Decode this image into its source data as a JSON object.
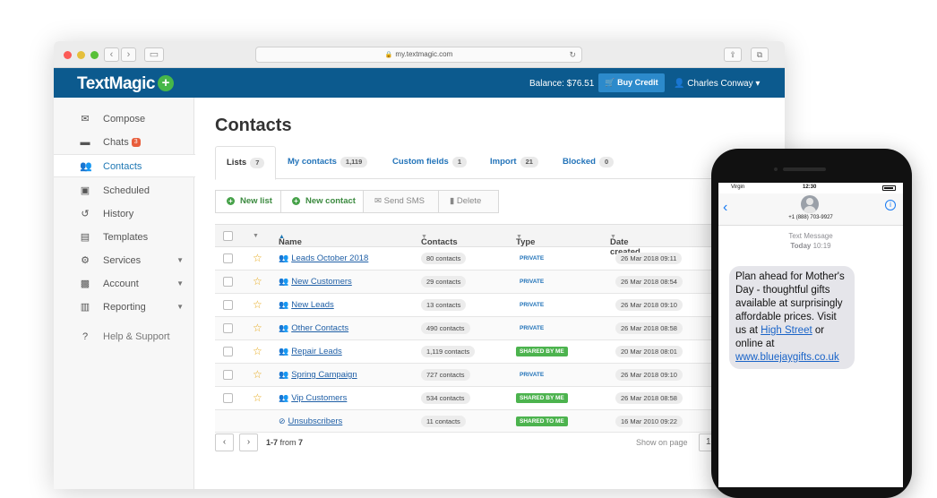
{
  "browser": {
    "url": "my.textmagic.com"
  },
  "header": {
    "logo": "TextMagic",
    "logo_plus": "+",
    "balance": "Balance: $76.51",
    "buy_credit": "Buy Credit",
    "user": "Charles Conway ▾"
  },
  "sidebar": {
    "items": [
      {
        "label": "Compose"
      },
      {
        "label": "Chats",
        "badge": "3"
      },
      {
        "label": "Contacts"
      },
      {
        "label": "Scheduled"
      },
      {
        "label": "History"
      },
      {
        "label": "Templates"
      },
      {
        "label": "Services"
      },
      {
        "label": "Account"
      },
      {
        "label": "Reporting"
      },
      {
        "label": "Help & Support"
      }
    ]
  },
  "main": {
    "title": "Contacts",
    "tabs": [
      {
        "label": "Lists",
        "count": "7"
      },
      {
        "label": "My contacts",
        "count": "1,119"
      },
      {
        "label": "Custom fields",
        "count": "1"
      },
      {
        "label": "Import",
        "count": "21"
      },
      {
        "label": "Blocked",
        "count": "0"
      }
    ],
    "toolbar": {
      "new_list": "New list",
      "new_contact": "New contact",
      "send_sms": "Send SMS",
      "delete": "Delete"
    },
    "columns": {
      "name": "Name",
      "contacts": "Contacts",
      "type": "Type",
      "date": "Date created"
    },
    "rows": [
      {
        "name": "Leads October 2018",
        "contacts": "80 contacts",
        "type": "PRIVATE",
        "date": "26 Mar 2018 09:11"
      },
      {
        "name": "New Customers",
        "contacts": "29 contacts",
        "type": "PRIVATE",
        "date": "26 Mar 2018 08:54"
      },
      {
        "name": "New Leads",
        "contacts": "13 contacts",
        "type": "PRIVATE",
        "date": "26 Mar 2018 09:10"
      },
      {
        "name": "Other Contacts",
        "contacts": "490 contacts",
        "type": "PRIVATE",
        "date": "26 Mar 2018 08:58"
      },
      {
        "name": "Repair Leads",
        "contacts": "1,119 contacts",
        "type": "SHARED BY ME",
        "date": "20 Mar 2018 08:01"
      },
      {
        "name": "Spring Campaign",
        "contacts": "727 contacts",
        "type": "PRIVATE",
        "date": "26 Mar 2018 09:10"
      },
      {
        "name": "Vip Customers",
        "contacts": "534 contacts",
        "type": "SHARED BY ME",
        "date": "26 Mar 2018 08:58"
      },
      {
        "name": "Unsubscribers",
        "contacts": "11 contacts",
        "type": "SHARED TO ME",
        "date": "16 Mar 2010 09:22"
      }
    ],
    "pager": {
      "range": "1-7",
      "from_label": "from",
      "total": "7",
      "show_on_page": "Show on page",
      "per_page": "10"
    }
  },
  "phone": {
    "carrier": "Virgin",
    "time": "12:30",
    "number": "+1 (888) 703-9927",
    "label": "Text Message",
    "day": "Today",
    "msg_time": "10:19",
    "message_pre": "Plan ahead for Mother's Day - thoughtful gifts available at surprisingly affordable prices. Visit us at ",
    "link1": "High Street",
    "message_mid": " or online at ",
    "link2": "www.bluejaygifts.co.uk"
  },
  "colors": {
    "header_bg": "#0c5a8e",
    "accent": "#2c8acb",
    "green": "#47b749",
    "shared": "#4cb34e"
  }
}
